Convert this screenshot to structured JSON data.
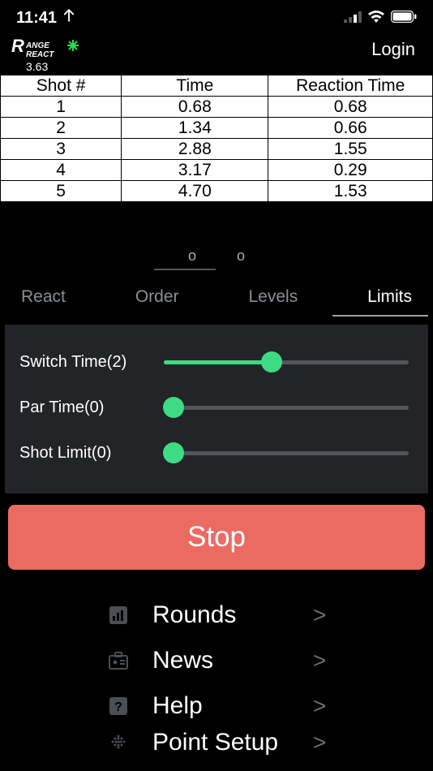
{
  "status": {
    "time": "11:41"
  },
  "header": {
    "version": "3.63",
    "login": "Login"
  },
  "table": {
    "headers": [
      "Shot #",
      "Time",
      "Reaction Time"
    ],
    "rows": [
      [
        "1",
        "0.68",
        "0.68"
      ],
      [
        "2",
        "1.34",
        "0.66"
      ],
      [
        "3",
        "2.88",
        "1.55"
      ],
      [
        "4",
        "3.17",
        "0.29"
      ],
      [
        "5",
        "4.70",
        "1.53"
      ]
    ]
  },
  "page_dots": [
    "o",
    "o"
  ],
  "tabs": {
    "items": [
      "React",
      "Order",
      "Levels",
      "Limits"
    ],
    "active_index": 3
  },
  "limits": {
    "switch_time": {
      "label": "Switch Time(2)",
      "value": 2,
      "fill_pct": 44
    },
    "par_time": {
      "label": "Par Time(0)",
      "value": 0,
      "fill_pct": 4
    },
    "shot_limit": {
      "label": "Shot Limit(0)",
      "value": 0,
      "fill_pct": 4
    }
  },
  "stop_button": "Stop",
  "menu": {
    "items": [
      {
        "icon": "bar-chart-icon",
        "label": "Rounds"
      },
      {
        "icon": "id-card-icon",
        "label": "News"
      },
      {
        "icon": "help-icon",
        "label": "Help"
      },
      {
        "icon": "grid-icon",
        "label": "Point Setup"
      }
    ]
  },
  "chevron": ">"
}
